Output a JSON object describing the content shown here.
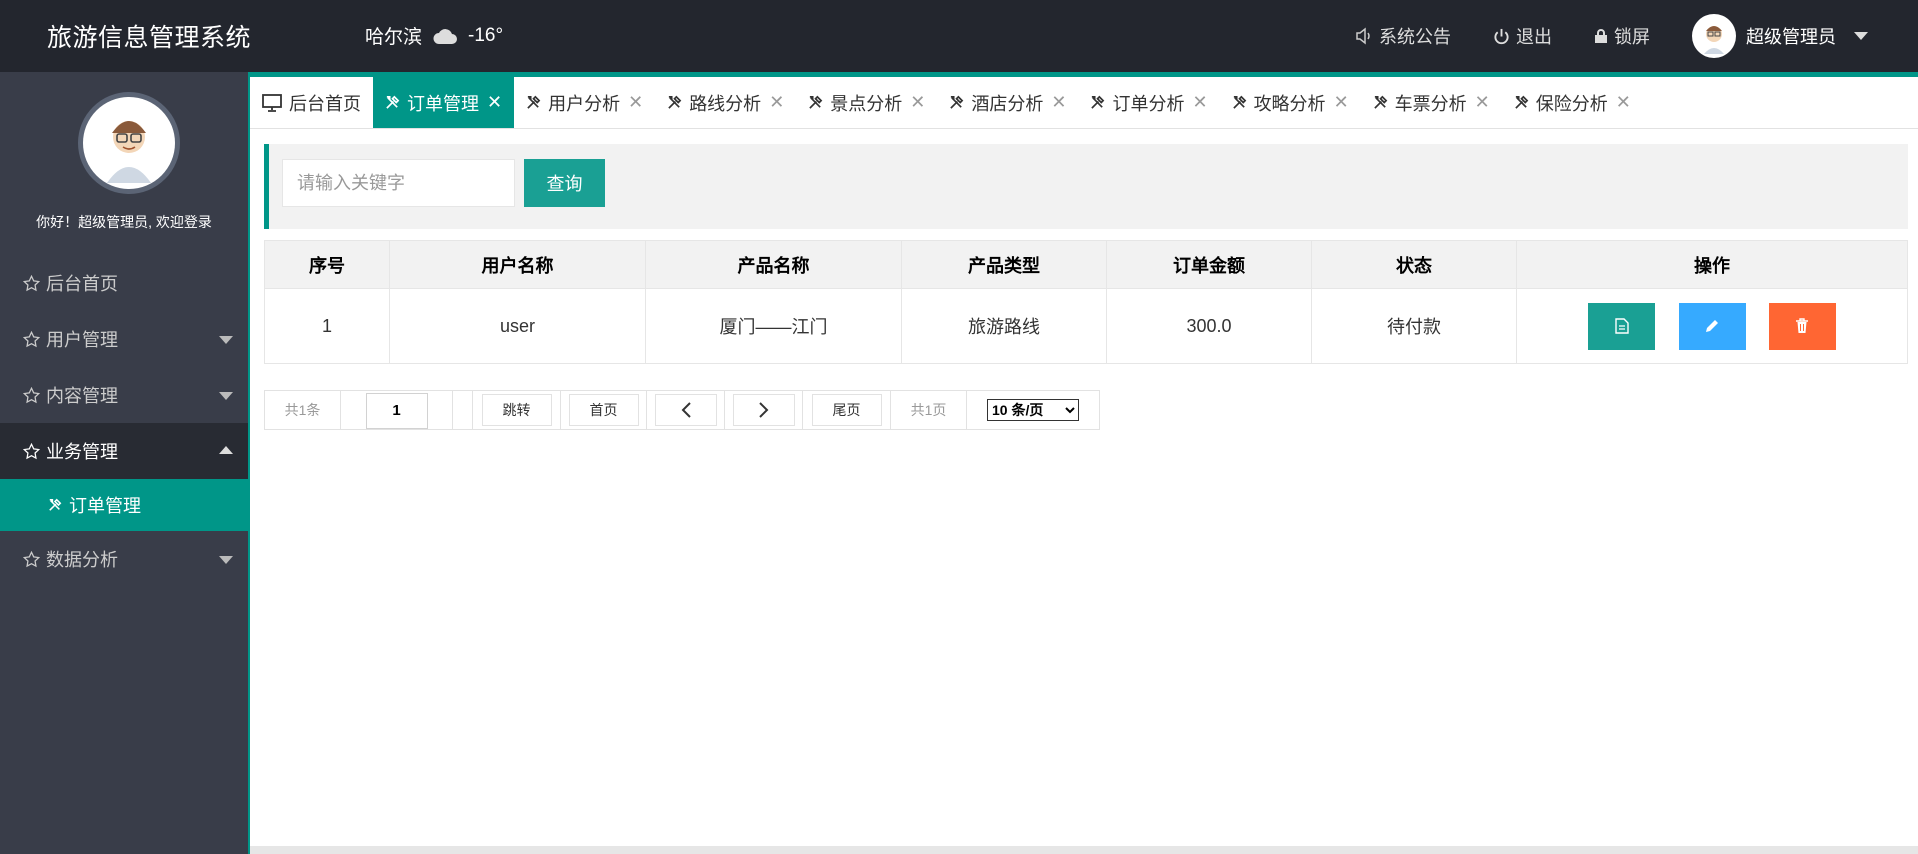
{
  "app": {
    "title": "旅游信息管理系统"
  },
  "weather": {
    "city": "哈尔滨",
    "icon": "cloud-icon",
    "temp": "-16°"
  },
  "topnav": {
    "announcement": "系统公告",
    "logout": "退出",
    "lock": "锁屏",
    "user": "超级管理员"
  },
  "sidebar": {
    "welcome": "你好！超级管理员, 欢迎登录",
    "items": [
      {
        "label": "后台首页"
      },
      {
        "label": "用户管理"
      },
      {
        "label": "内容管理"
      },
      {
        "label": "业务管理"
      },
      {
        "label": "数据分析"
      }
    ],
    "sub_item": "订单管理"
  },
  "tabs": [
    {
      "label": "后台首页",
      "icon": "monitor-icon"
    },
    {
      "label": "订单管理",
      "icon": "tools-icon"
    },
    {
      "label": "用户分析",
      "icon": "tools-icon"
    },
    {
      "label": "路线分析",
      "icon": "tools-icon"
    },
    {
      "label": "景点分析",
      "icon": "tools-icon"
    },
    {
      "label": "酒店分析",
      "icon": "tools-icon"
    },
    {
      "label": "订单分析",
      "icon": "tools-icon"
    },
    {
      "label": "攻略分析",
      "icon": "tools-icon"
    },
    {
      "label": "车票分析",
      "icon": "tools-icon"
    },
    {
      "label": "保险分析",
      "icon": "tools-icon"
    }
  ],
  "search": {
    "placeholder": "请输入关键字",
    "button": "查询"
  },
  "table": {
    "headers": [
      "序号",
      "用户名称",
      "产品名称",
      "产品类型",
      "订单金额",
      "状态",
      "操作"
    ],
    "rows": [
      [
        "1",
        "user",
        "厦门——江门",
        "旅游路线",
        "300.0",
        "待付款"
      ]
    ]
  },
  "pager": {
    "total": "共1条",
    "page": "1",
    "jump": "跳转",
    "first": "首页",
    "last": "尾页",
    "pages": "共1页",
    "page_size": "10 条/页"
  },
  "colors": {
    "accent": "#009688",
    "topbar": "#23262e",
    "sidebar": "#393d49",
    "edit": "#36aaff",
    "delete": "#ff6633"
  }
}
